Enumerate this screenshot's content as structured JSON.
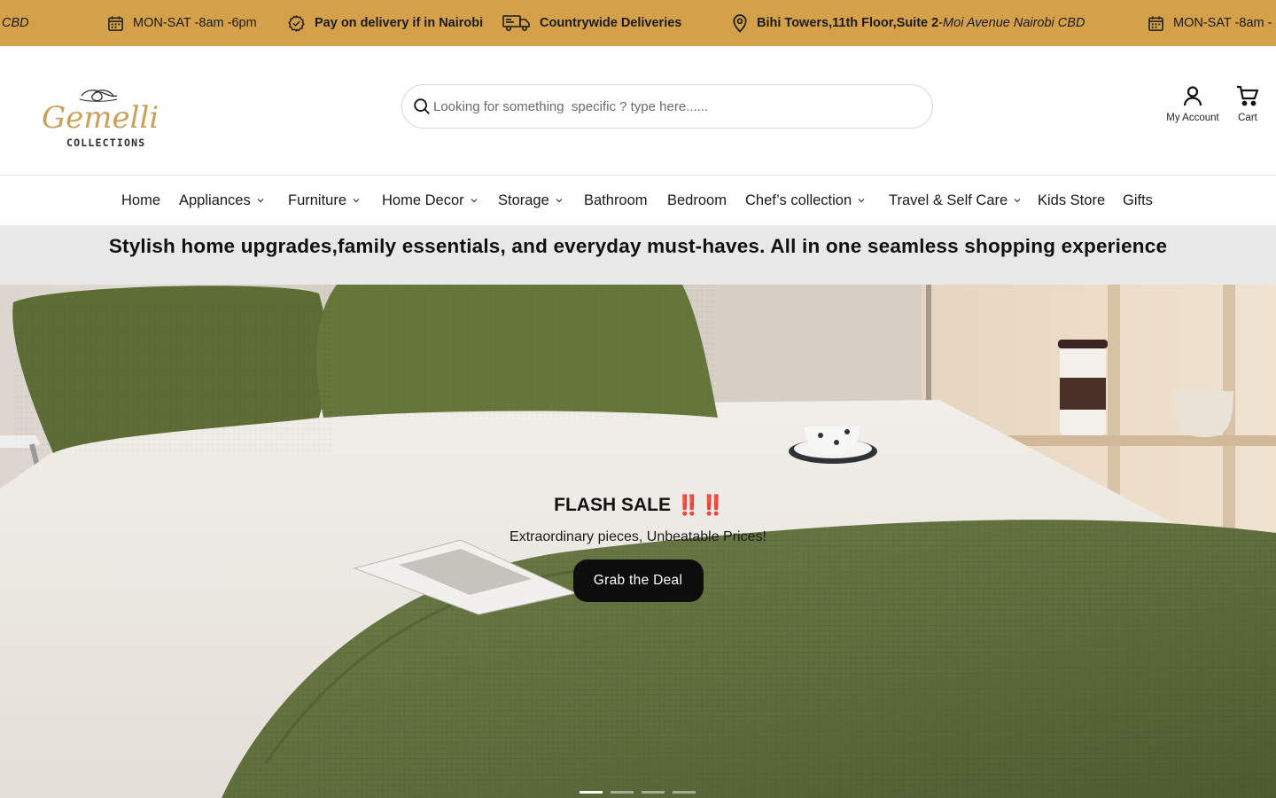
{
  "announcements": {
    "location_tail": "CBD",
    "hours": "MON-SAT -8am -6pm",
    "payment": "Pay on delivery if in Nairobi",
    "delivery": "Countrywide Deliveries",
    "address_bold": "Bihi Towers,11th Floor,Suite 2",
    "address_sep": "-",
    "address_italic": "Moi Avenue Nairobi CBD",
    "hours_repeat": "MON-SAT -8am -"
  },
  "brand": {
    "name": "Gemelli",
    "sub": "COLLECTIONS"
  },
  "search": {
    "placeholder": "Looking for something  specific ? type here......"
  },
  "header_actions": {
    "account": "My Account",
    "cart": "Cart"
  },
  "nav": {
    "items": [
      {
        "label": "Home",
        "dropdown": false
      },
      {
        "label": "Appliances",
        "dropdown": true
      },
      {
        "label": "Furniture",
        "dropdown": true
      },
      {
        "label": "Home Decor",
        "dropdown": true
      },
      {
        "label": "Storage",
        "dropdown": true
      },
      {
        "label": "Bathroom",
        "dropdown": false
      },
      {
        "label": "Bedroom",
        "dropdown": false
      },
      {
        "label": "Chef’s collection",
        "dropdown": true
      },
      {
        "label": "Travel & Self Care",
        "dropdown": true
      },
      {
        "label": "Kids Store",
        "dropdown": false
      },
      {
        "label": "Gifts",
        "dropdown": false
      }
    ]
  },
  "tagline": "Stylish home upgrades,family essentials, and everyday must-haves. All in one seamless shopping experience",
  "hero": {
    "title": "FLASH SALE",
    "title_marks": "‼️ ‼️",
    "subtitle": "Extraordinary pieces, Unbeatable Prices!",
    "cta": "Grab the Deal",
    "slides_total": 4,
    "active_slide": 1
  },
  "colors": {
    "topbar": "#d4a04a",
    "tagline_bg": "#e8e8e8",
    "cta_bg": "#0d0d0d",
    "brand_gold": "#c9a15a"
  },
  "icons": [
    "calendar-icon",
    "badge-check-icon",
    "truck-icon",
    "map-pin-icon",
    "search-icon",
    "user-icon",
    "cart-icon",
    "chevron-down-icon"
  ]
}
